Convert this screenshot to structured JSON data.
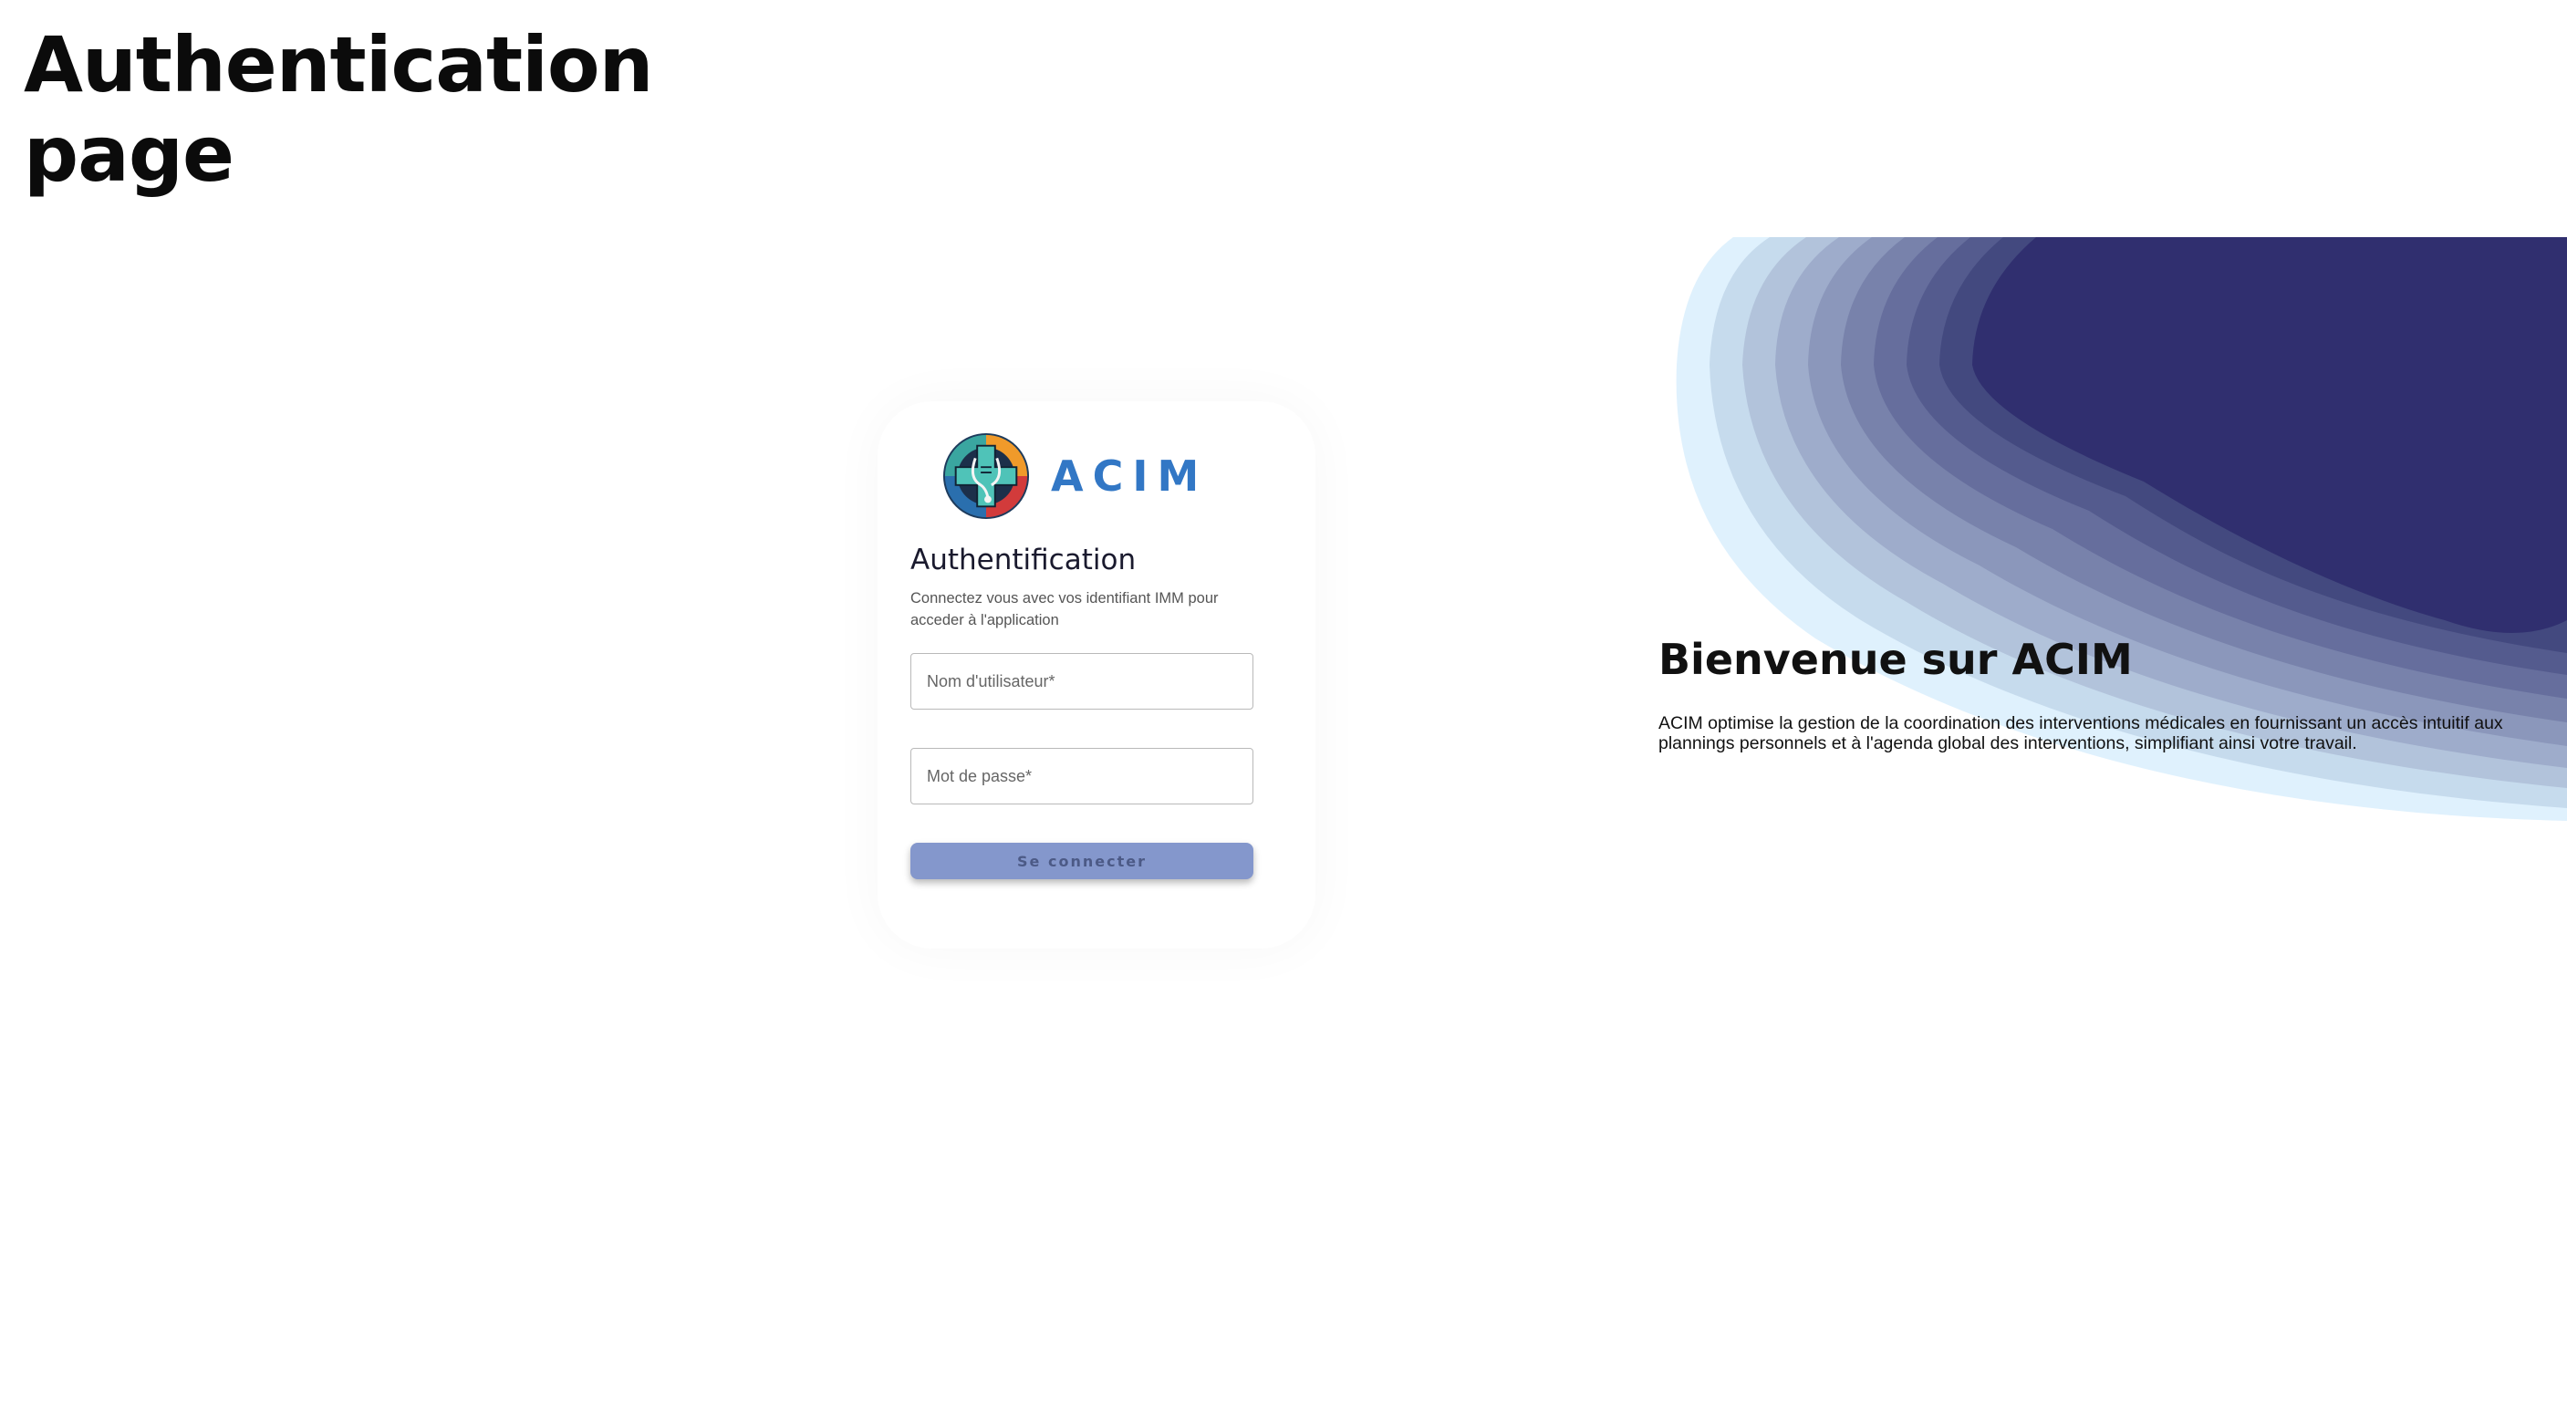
{
  "frame": {
    "title_line1": "Authentication",
    "title_line2": "page"
  },
  "login": {
    "logo_text": "ACIM",
    "heading": "Authentification",
    "subtitle": "Connectez vous avec vos identifiant IMM pour acceder à l'application",
    "username_placeholder": "Nom d'utilisateur*",
    "password_placeholder": "Mot de passe*",
    "submit_label": "Se connecter"
  },
  "welcome": {
    "title": "Bienvenue sur ACIM",
    "description": "ACIM optimise la gestion de la coordination des interventions médicales en fournissant un accès intuitif aux plannings personnels et à l'agenda global des interventions, simplifiant ainsi votre travail."
  },
  "colors": {
    "brand_blue": "#3277c5",
    "button": "#8497cc",
    "wave_darkest": "#302f6f",
    "wave_lightest": "#dff1fd"
  },
  "icons": {
    "logo": "medical-cross-emblem-icon"
  }
}
